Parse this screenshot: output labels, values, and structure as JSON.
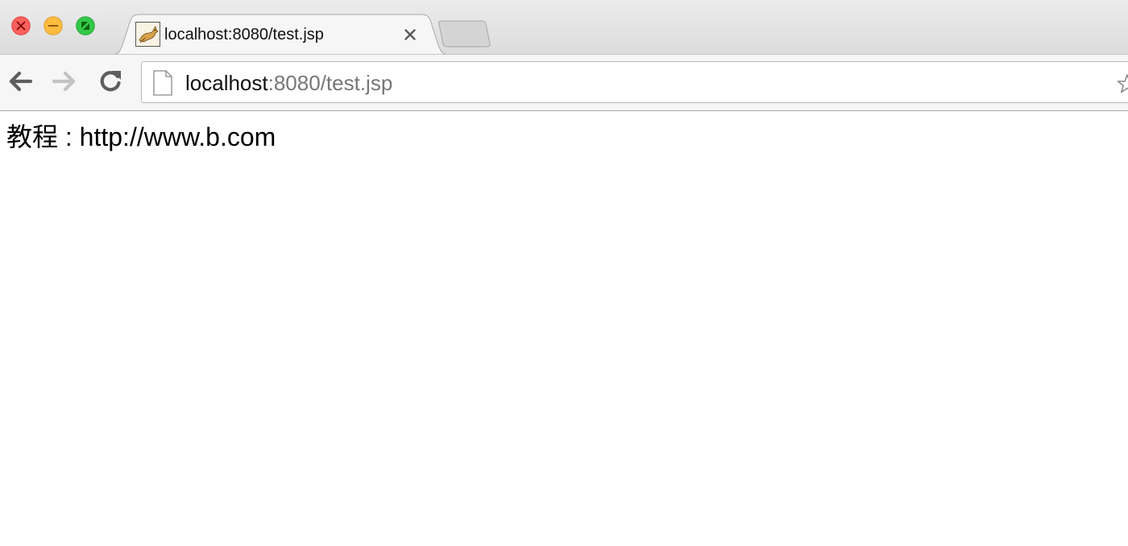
{
  "window": {
    "controls": {
      "close_icon": "close-traffic-light",
      "minimize_icon": "minimize-traffic-light",
      "maximize_icon": "maximize-traffic-light",
      "colors": {
        "close": "#fc605c",
        "minimize": "#fdbc40",
        "maximize": "#34c84a"
      }
    }
  },
  "tabs": [
    {
      "title": "localhost:8080/test.jsp",
      "favicon": "tomcat-icon",
      "active": true
    }
  ],
  "toolbar": {
    "back_icon": "back-arrow-icon",
    "forward_icon": "forward-arrow-icon",
    "reload_icon": "reload-icon",
    "address": {
      "host": "localhost",
      "rest": ":8080/test.jsp",
      "page_icon": "document-icon",
      "bookmark_icon": "star-icon"
    }
  },
  "page": {
    "text": "教程 : http://www.b.com"
  }
}
